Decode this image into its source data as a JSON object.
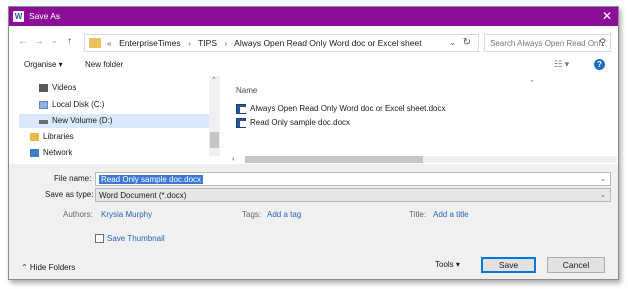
{
  "window": {
    "title": "Save As",
    "app_icon_letter": "W",
    "close_glyph": "✕",
    "title_color": "#8b0e97"
  },
  "nav": {
    "back_glyph": "←",
    "forward_glyph": "→",
    "recent_glyph": "⌄",
    "up_glyph": "↑",
    "breadcrumb_prefix": "«",
    "breadcrumbs": [
      "EnterpriseTimes",
      "TIPS",
      "Always Open Read Only Word doc or Excel sheet"
    ],
    "breadcrumb_sep": "›",
    "dropdown_glyph": "⌄",
    "refresh_glyph": "↻",
    "search_placeholder": "Search Always Open Read Onl...",
    "search_glyph": "⚲"
  },
  "toolbar": {
    "organise": "Organise ▾",
    "new_folder": "New folder",
    "views_glyph": "☷ ▾",
    "help_glyph": "?"
  },
  "sidebar": {
    "items": [
      {
        "label": "Videos",
        "icon": "videos-icon"
      },
      {
        "label": "Local Disk (C:)",
        "icon": "local-disk-icon"
      },
      {
        "label": "New Volume (D:)",
        "icon": "drive-icon",
        "selected": true
      },
      {
        "label": "Libraries",
        "icon": "libraries-icon"
      },
      {
        "label": "Network",
        "icon": "network-icon"
      }
    ],
    "scroll_up_glyph": "⌃"
  },
  "files": {
    "column_name": "Name",
    "sort_glyph": "⌃",
    "items": [
      "Always Open Read Only Word doc or Excel sheet.docx",
      "Read Only sample doc.docx"
    ],
    "scroll_left_glyph": "‹"
  },
  "form": {
    "file_name_label": "File name:",
    "file_name_value": "Read Only sample doc.docx",
    "save_as_type_label": "Save as type:",
    "save_as_type_value": "Word Document (*.docx)",
    "dropdown_glyph": "⌄",
    "authors_label": "Authors:",
    "authors_value": "Krysia Murphy",
    "tags_label": "Tags:",
    "tags_value": "Add a tag",
    "title_label": "Title:",
    "title_value": "Add a title",
    "thumbnail_label": "Save Thumbnail",
    "thumbnail_checked": false
  },
  "footer": {
    "hide_folders": "⌃ Hide Folders",
    "tools": "Tools   ▾",
    "save": "Save",
    "cancel": "Cancel"
  }
}
